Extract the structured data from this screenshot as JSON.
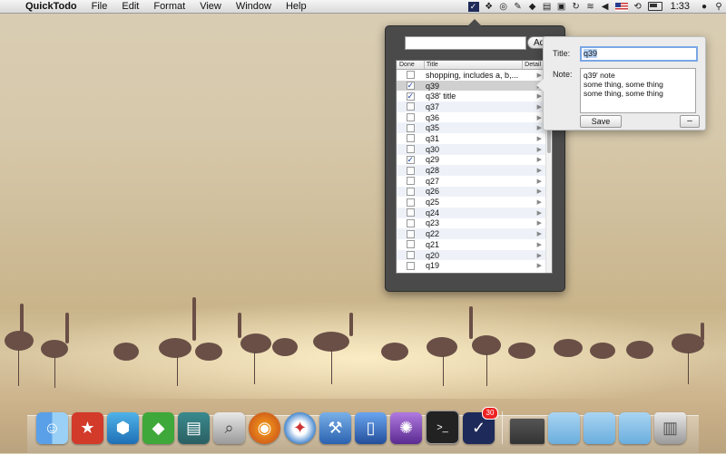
{
  "menubar": {
    "app_name": "QuickTodo",
    "items": [
      "File",
      "Edit",
      "Format",
      "View",
      "Window",
      "Help"
    ],
    "clock": "1:33"
  },
  "popover": {
    "new_placeholder": "",
    "add_label": "Add",
    "columns": {
      "done": "Done",
      "title": "Title",
      "detail": "Detail"
    },
    "rows": [
      {
        "title": "shopping, includes a, b,...",
        "done": false
      },
      {
        "title": "q39",
        "done": true
      },
      {
        "title": "q38' title",
        "done": true
      },
      {
        "title": "q37",
        "done": false
      },
      {
        "title": "q36",
        "done": false
      },
      {
        "title": "q35",
        "done": false
      },
      {
        "title": "q31",
        "done": false
      },
      {
        "title": "q30",
        "done": false
      },
      {
        "title": "q29",
        "done": true
      },
      {
        "title": "q28",
        "done": false
      },
      {
        "title": "q27",
        "done": false
      },
      {
        "title": "q26",
        "done": false
      },
      {
        "title": "q25",
        "done": false
      },
      {
        "title": "q24",
        "done": false
      },
      {
        "title": "q23",
        "done": false
      },
      {
        "title": "q22",
        "done": false
      },
      {
        "title": "q21",
        "done": false
      },
      {
        "title": "q20",
        "done": false
      },
      {
        "title": "q19",
        "done": false
      }
    ],
    "selected_row": 1,
    "detail_glyph": "▶"
  },
  "detail": {
    "title_label": "Title:",
    "title_value": "q39",
    "note_label": "Note:",
    "note_value": "q39' note\nsome thing, some thing\nsome thing, some thing",
    "save_label": "Save",
    "minus_label": "–"
  },
  "dock": {
    "badge": "30"
  }
}
